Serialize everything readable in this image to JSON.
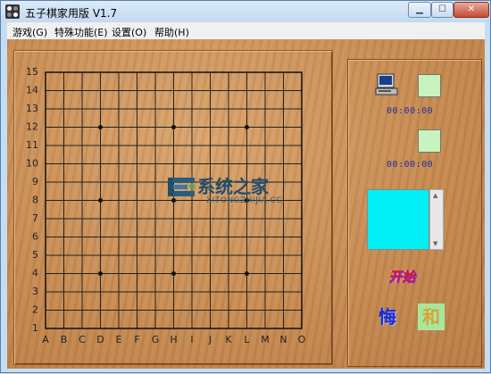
{
  "window": {
    "title": "五子棋家用版 V1.7"
  },
  "menu": [
    {
      "label": "游戏(G)"
    },
    {
      "label": "特殊功能(E)"
    },
    {
      "label": "设置(O)"
    },
    {
      "label": "帮助(H)"
    }
  ],
  "board": {
    "columns": [
      "A",
      "B",
      "C",
      "D",
      "E",
      "F",
      "G",
      "H",
      "I",
      "J",
      "K",
      "L",
      "M",
      "N",
      "O"
    ],
    "rows": [
      "15",
      "14",
      "13",
      "12",
      "11",
      "10",
      "9",
      "8",
      "7",
      "6",
      "5",
      "4",
      "3",
      "2",
      "1"
    ],
    "star_points": [
      [
        "D",
        12
      ],
      [
        "H",
        12
      ],
      [
        "L",
        12
      ],
      [
        "D",
        8
      ],
      [
        "H",
        8
      ],
      [
        "L",
        8
      ],
      [
        "D",
        4
      ],
      [
        "H",
        4
      ],
      [
        "L",
        4
      ]
    ]
  },
  "players": {
    "computer_timer": "00:00:00",
    "player_timer": "00:00:00"
  },
  "controls": {
    "start_label": "开始",
    "undo_label": "悔",
    "draw_label": "和"
  },
  "watermark": {
    "text": "系统之家",
    "sub": "XITONGZHIJIA.CC"
  },
  "colors": {
    "swatch": "#c9f2c1",
    "message_box": "#00f0f5",
    "board_wood": "#c98c52"
  }
}
